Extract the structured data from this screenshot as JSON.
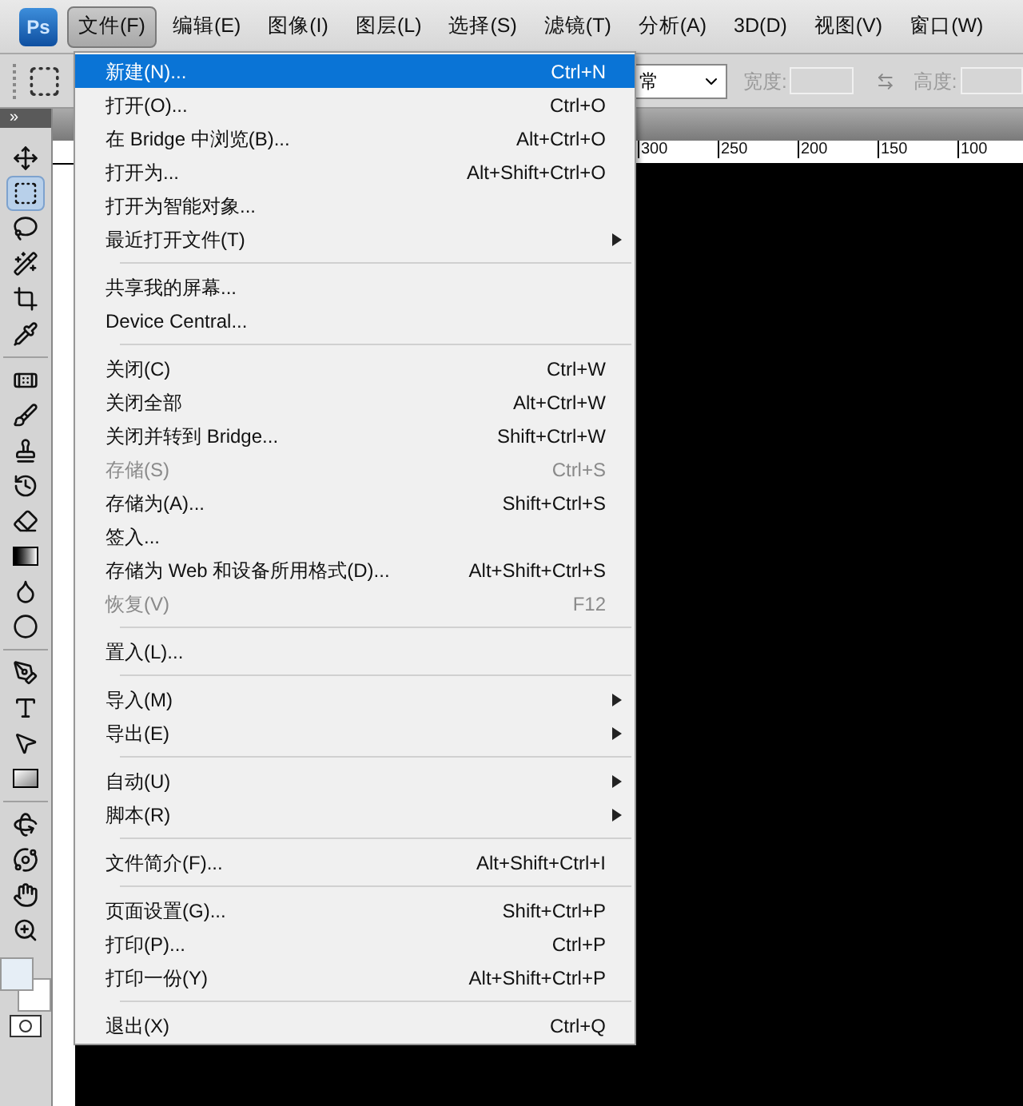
{
  "app_logo": "Ps",
  "menubar": [
    {
      "label": "文件(F)",
      "selected": true
    },
    {
      "label": "编辑(E)",
      "selected": false
    },
    {
      "label": "图像(I)",
      "selected": false
    },
    {
      "label": "图层(L)",
      "selected": false
    },
    {
      "label": "选择(S)",
      "selected": false
    },
    {
      "label": "滤镜(T)",
      "selected": false
    },
    {
      "label": "分析(A)",
      "selected": false
    },
    {
      "label": "3D(D)",
      "selected": false
    },
    {
      "label": "视图(V)",
      "selected": false
    },
    {
      "label": "窗口(W)",
      "selected": false
    }
  ],
  "options_bar": {
    "style_value": "常",
    "width_label": "宽度:",
    "height_label": "高度:"
  },
  "toolbox_collapse": "»",
  "ruler": {
    "ticks": [
      "300",
      "250",
      "200",
      "150",
      "100"
    ]
  },
  "tools": [
    {
      "kind": "move",
      "selected": false
    },
    {
      "kind": "marquee",
      "selected": true
    },
    {
      "kind": "lasso",
      "selected": false
    },
    {
      "kind": "wand",
      "selected": false
    },
    {
      "kind": "crop",
      "selected": false
    },
    {
      "kind": "eyedropper",
      "selected": false
    },
    {
      "kind": "separator"
    },
    {
      "kind": "bandage",
      "selected": false
    },
    {
      "kind": "brush",
      "selected": false
    },
    {
      "kind": "stamp",
      "selected": false
    },
    {
      "kind": "history",
      "selected": false
    },
    {
      "kind": "eraser",
      "selected": false
    },
    {
      "kind": "gradient",
      "selected": false
    },
    {
      "kind": "drop",
      "selected": false
    },
    {
      "kind": "burn",
      "selected": false
    },
    {
      "kind": "separator"
    },
    {
      "kind": "pen",
      "selected": false
    },
    {
      "kind": "type",
      "selected": false
    },
    {
      "kind": "pointer",
      "selected": false
    },
    {
      "kind": "shape",
      "selected": false
    },
    {
      "kind": "separator"
    },
    {
      "kind": "rotate3d",
      "selected": false
    },
    {
      "kind": "orbit",
      "selected": false
    },
    {
      "kind": "hand",
      "selected": false
    },
    {
      "kind": "zoom",
      "selected": false
    }
  ],
  "file_menu": [
    {
      "kind": "item",
      "label": "新建(N)...",
      "shortcut": "Ctrl+N",
      "selected": true,
      "disabled": false,
      "submenu": false
    },
    {
      "kind": "item",
      "label": "打开(O)...",
      "shortcut": "Ctrl+O",
      "selected": false,
      "disabled": false,
      "submenu": false
    },
    {
      "kind": "item",
      "label": "在 Bridge 中浏览(B)...",
      "shortcut": "Alt+Ctrl+O",
      "selected": false,
      "disabled": false,
      "submenu": false
    },
    {
      "kind": "item",
      "label": "打开为...",
      "shortcut": "Alt+Shift+Ctrl+O",
      "selected": false,
      "disabled": false,
      "submenu": false
    },
    {
      "kind": "item",
      "label": "打开为智能对象...",
      "selected": false,
      "disabled": false,
      "submenu": false
    },
    {
      "kind": "item",
      "label": "最近打开文件(T)",
      "selected": false,
      "disabled": false,
      "submenu": true
    },
    {
      "kind": "separator"
    },
    {
      "kind": "item",
      "label": "共享我的屏幕...",
      "selected": false,
      "disabled": false,
      "submenu": false
    },
    {
      "kind": "item",
      "label": "Device Central...",
      "selected": false,
      "disabled": false,
      "submenu": false
    },
    {
      "kind": "separator"
    },
    {
      "kind": "item",
      "label": "关闭(C)",
      "shortcut": "Ctrl+W",
      "selected": false,
      "disabled": false,
      "submenu": false
    },
    {
      "kind": "item",
      "label": "关闭全部",
      "shortcut": "Alt+Ctrl+W",
      "selected": false,
      "disabled": false,
      "submenu": false
    },
    {
      "kind": "item",
      "label": "关闭并转到 Bridge...",
      "shortcut": "Shift+Ctrl+W",
      "selected": false,
      "disabled": false,
      "submenu": false
    },
    {
      "kind": "item",
      "label": "存储(S)",
      "shortcut": "Ctrl+S",
      "selected": false,
      "disabled": true,
      "submenu": false
    },
    {
      "kind": "item",
      "label": "存储为(A)...",
      "shortcut": "Shift+Ctrl+S",
      "selected": false,
      "disabled": false,
      "submenu": false
    },
    {
      "kind": "item",
      "label": "签入...",
      "selected": false,
      "disabled": false,
      "submenu": false
    },
    {
      "kind": "item",
      "label": "存储为 Web 和设备所用格式(D)...",
      "shortcut": "Alt+Shift+Ctrl+S",
      "selected": false,
      "disabled": false,
      "submenu": false
    },
    {
      "kind": "item",
      "label": "恢复(V)",
      "shortcut": "F12",
      "selected": false,
      "disabled": true,
      "submenu": false
    },
    {
      "kind": "separator"
    },
    {
      "kind": "item",
      "label": "置入(L)...",
      "selected": false,
      "disabled": false,
      "submenu": false
    },
    {
      "kind": "separator"
    },
    {
      "kind": "item",
      "label": "导入(M)",
      "selected": false,
      "disabled": false,
      "submenu": true
    },
    {
      "kind": "item",
      "label": "导出(E)",
      "selected": false,
      "disabled": false,
      "submenu": true
    },
    {
      "kind": "separator"
    },
    {
      "kind": "item",
      "label": "自动(U)",
      "selected": false,
      "disabled": false,
      "submenu": true
    },
    {
      "kind": "item",
      "label": "脚本(R)",
      "selected": false,
      "disabled": false,
      "submenu": true
    },
    {
      "kind": "separator"
    },
    {
      "kind": "item",
      "label": "文件简介(F)...",
      "shortcut": "Alt+Shift+Ctrl+I",
      "selected": false,
      "disabled": false,
      "submenu": false
    },
    {
      "kind": "separator"
    },
    {
      "kind": "item",
      "label": "页面设置(G)...",
      "shortcut": "Shift+Ctrl+P",
      "selected": false,
      "disabled": false,
      "submenu": false
    },
    {
      "kind": "item",
      "label": "打印(P)...",
      "shortcut": "Ctrl+P",
      "selected": false,
      "disabled": false,
      "submenu": false
    },
    {
      "kind": "item",
      "label": "打印一份(Y)",
      "shortcut": "Alt+Shift+Ctrl+P",
      "selected": false,
      "disabled": false,
      "submenu": false
    },
    {
      "kind": "separator"
    },
    {
      "kind": "item",
      "label": "退出(X)",
      "shortcut": "Ctrl+Q",
      "selected": false,
      "disabled": false,
      "submenu": false
    }
  ]
}
